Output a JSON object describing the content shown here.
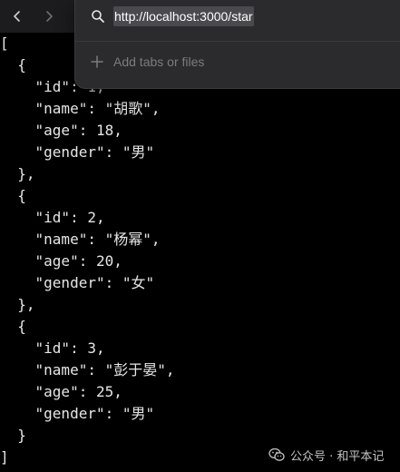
{
  "toolbar": {
    "back_icon": "chevron-left-icon",
    "forward_icon": "chevron-right-icon"
  },
  "address_popup": {
    "search_icon": "search-icon",
    "url": "http://localhost:3000/star",
    "add_icon": "plus-icon",
    "add_label": "Add tabs or files"
  },
  "json_lines": [
    "[",
    "  {",
    "    \"id\": 1,",
    "    \"name\": \"胡歌\",",
    "    \"age\": 18,",
    "    \"gender\": \"男\"",
    "  },",
    "  {",
    "    \"id\": 2,",
    "    \"name\": \"杨幂\",",
    "    \"age\": 20,",
    "    \"gender\": \"女\"",
    "  },",
    "  {",
    "    \"id\": 3,",
    "    \"name\": \"彭于晏\",",
    "    \"age\": 25,",
    "    \"gender\": \"男\"",
    "  }",
    "]"
  ],
  "watermark": {
    "icon": "wechat-icon",
    "text": "公众号 · 和平本记"
  },
  "colors": {
    "background": "#000000",
    "text": "#e6e6e6",
    "popup_bg": "#2b2b2d",
    "url_highlight": "#4a4a4e",
    "muted": "#7b7b80"
  }
}
